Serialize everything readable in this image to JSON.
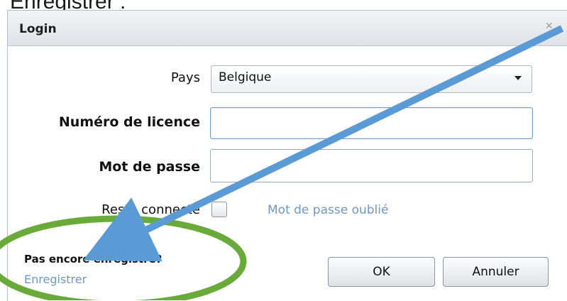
{
  "caption": "Enregistrer :",
  "dialog": {
    "title": "Login",
    "close_glyph": "✕"
  },
  "form": {
    "country_label": "Pays",
    "country_value": "Belgique",
    "license_label": "Numéro de licence",
    "license_value": "",
    "password_label": "Mot de passe",
    "password_value": "",
    "remember_label": "Reste connecté",
    "remember_checked": false,
    "forgot_link": "Mot de passe oublié"
  },
  "register": {
    "question": "Pas encore enregistré?",
    "link": "Enregistrer"
  },
  "buttons": {
    "ok": "OK",
    "cancel": "Annuler"
  },
  "annotation": {
    "arrow_color": "#5b9bd5",
    "ellipse_color": "#6aaa3a"
  }
}
